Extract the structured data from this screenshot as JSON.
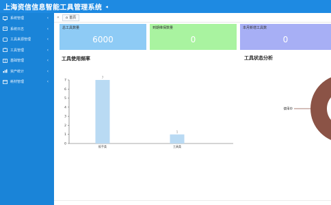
{
  "header": {
    "app_title": "上海资信信息智能工具管理系统",
    "collapse_icon": "triangle-left-icon"
  },
  "sidebar": {
    "items": [
      {
        "label": "系统管理",
        "icon": "monitor-icon"
      },
      {
        "label": "系统日志",
        "icon": "log-icon"
      },
      {
        "label": "工具来源管理",
        "icon": "source-icon"
      },
      {
        "label": "工具管理",
        "icon": "tool-icon"
      },
      {
        "label": "基础管理",
        "icon": "base-icon"
      },
      {
        "label": "资产统计",
        "icon": "stats-icon"
      },
      {
        "label": "耗材管理",
        "icon": "supplies-icon"
      }
    ]
  },
  "tabs": {
    "home_label": "首页"
  },
  "cards": [
    {
      "label": "总工具数量",
      "value": "6000",
      "color": "#8ecbf5"
    },
    {
      "label": "到期维保数量",
      "value": "0",
      "color": "#a9f3a0"
    },
    {
      "label": "本月新增工具数",
      "value": "0",
      "color": "#a7aff5"
    }
  ],
  "sections": {
    "frequency_title": "工具使用频率",
    "status_title": "工具状态分析"
  },
  "pie_label": "使用中",
  "chart_data": [
    {
      "type": "bar",
      "title": "工具使用频率",
      "categories": [
        "扳手类",
        "工具类"
      ],
      "values": [
        7,
        1
      ],
      "data_labels": [
        "7",
        "1"
      ],
      "ylim": [
        0,
        7
      ],
      "yticks": [
        "0",
        "1",
        "2",
        "3",
        "4",
        "5",
        "6",
        "7"
      ],
      "grid": false,
      "bar_color": "#b9daf3"
    },
    {
      "type": "pie",
      "title": "工具状态分析",
      "slices": [
        {
          "label": "使用中",
          "value": 100
        }
      ],
      "color": "#8b5346"
    }
  ]
}
